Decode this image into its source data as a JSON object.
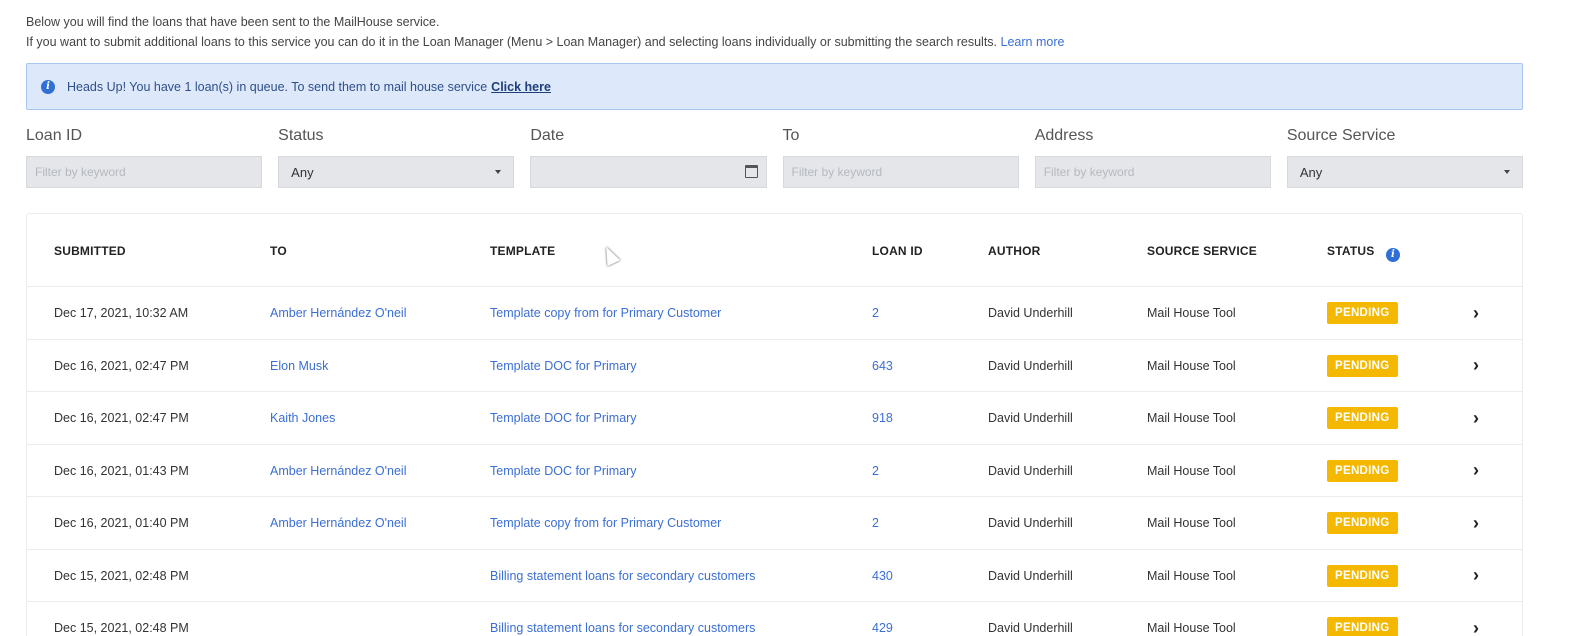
{
  "intro": {
    "line1": "Below you will find the loans that have been sent to the MailHouse service.",
    "line2": "If you want to submit additional loans to this service you can do it in the Loan Manager (Menu > Loan Manager) and selecting loans individually or submitting the search results.",
    "learn_more": "Learn more"
  },
  "alert": {
    "text": "Heads Up! You have 1 loan(s) in queue. To send them to mail house service",
    "link": "Click here"
  },
  "filters": {
    "loan_id": {
      "label": "Loan ID",
      "placeholder": "Filter by keyword"
    },
    "status": {
      "label": "Status",
      "value": "Any"
    },
    "date": {
      "label": "Date"
    },
    "to": {
      "label": "To",
      "placeholder": "Filter by keyword"
    },
    "address": {
      "label": "Address",
      "placeholder": "Filter by keyword"
    },
    "source_service": {
      "label": "Source Service",
      "value": "Any"
    }
  },
  "table": {
    "headers": {
      "submitted": "SUBMITTED",
      "to": "TO",
      "template": "TEMPLATE",
      "loan_id": "LOAN ID",
      "author": "AUTHOR",
      "source_service": "SOURCE SERVICE",
      "status": "STATUS"
    },
    "rows": [
      {
        "submitted": "Dec 17, 2021, 10:32 AM",
        "to": "Amber Hernández O'neil",
        "template": "Template copy from for Primary Customer",
        "loan_id": "2",
        "author": "David Underhill",
        "source": "Mail House Tool",
        "status": "PENDING"
      },
      {
        "submitted": "Dec 16, 2021, 02:47 PM",
        "to": "Elon Musk",
        "template": "Template DOC for Primary",
        "loan_id": "643",
        "author": "David Underhill",
        "source": "Mail House Tool",
        "status": "PENDING"
      },
      {
        "submitted": "Dec 16, 2021, 02:47 PM",
        "to": "Kaith Jones",
        "template": "Template DOC for Primary",
        "loan_id": "918",
        "author": "David Underhill",
        "source": "Mail House Tool",
        "status": "PENDING"
      },
      {
        "submitted": "Dec 16, 2021, 01:43 PM",
        "to": "Amber Hernández O'neil",
        "template": "Template DOC for Primary",
        "loan_id": "2",
        "author": "David Underhill",
        "source": "Mail House Tool",
        "status": "PENDING"
      },
      {
        "submitted": "Dec 16, 2021, 01:40 PM",
        "to": "Amber Hernández O'neil",
        "template": "Template copy from for Primary Customer",
        "loan_id": "2",
        "author": "David Underhill",
        "source": "Mail House Tool",
        "status": "PENDING"
      },
      {
        "submitted": "Dec 15, 2021, 02:48 PM",
        "to": "",
        "template": "Billing statement loans for secondary customers",
        "loan_id": "430",
        "author": "David Underhill",
        "source": "Mail House Tool",
        "status": "PENDING"
      },
      {
        "submitted": "Dec 15, 2021, 02:48 PM",
        "to": "",
        "template": "Billing statement loans for secondary customers",
        "loan_id": "429",
        "author": "David Underhill",
        "source": "Mail House Tool",
        "status": "PENDING"
      }
    ]
  },
  "colors": {
    "link": "#3b6fd4",
    "pending_badge": "#f5b800",
    "alert_bg": "#dde9fb"
  }
}
